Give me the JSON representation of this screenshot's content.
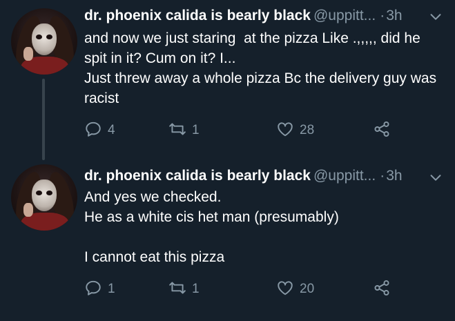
{
  "colors": {
    "background": "#15202b",
    "text_primary": "#ffffff",
    "text_secondary": "#8899a6",
    "thread_line": "#38444d"
  },
  "tweets": [
    {
      "author_name": "dr. phoenix calida is bearly black",
      "handle": "@uppitt...",
      "separator": "·",
      "time": "3h",
      "text": "and now we just staring  at the pizza Like .,,,,, did he spit in it? Cum on it? I...\nJust threw away a whole pizza Bc the delivery guy was racist",
      "reply_count": "4",
      "retweet_count": "1",
      "like_count": "28",
      "icons": [
        "reply-icon",
        "retweet-icon",
        "like-icon",
        "share-icon",
        "chevron-down-icon"
      ]
    },
    {
      "author_name": "dr. phoenix calida is bearly black",
      "handle": "@uppitt...",
      "separator": "·",
      "time": "3h",
      "text": "And yes we checked.\nHe as a white cis het man (presumably)\n\nI cannot eat this pizza",
      "reply_count": "1",
      "retweet_count": "1",
      "like_count": "20",
      "icons": [
        "reply-icon",
        "retweet-icon",
        "like-icon",
        "share-icon",
        "chevron-down-icon"
      ]
    }
  ]
}
